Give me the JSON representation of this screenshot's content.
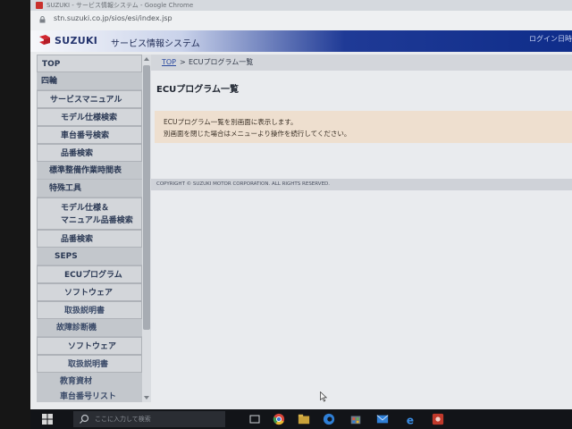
{
  "browser": {
    "title": "SUZUKI - サービス情報システム - Google Chrome",
    "url": "stn.suzuki.co.jp/sios/esi/index.jsp"
  },
  "header": {
    "brand": "SUZUKI",
    "system_name": "サービス情報システム",
    "login_text": "ログイン日時"
  },
  "sidebar": {
    "items": [
      {
        "label": "TOP"
      },
      {
        "label": "四輪"
      },
      {
        "label": "サービスマニュアル"
      },
      {
        "label": "モデル仕様検索"
      },
      {
        "label": "車台番号検索"
      },
      {
        "label": "品番検索"
      },
      {
        "label": "標準整備作業時間表"
      },
      {
        "label": "特殊工具"
      },
      {
        "label": "モデル仕様＆\nマニュアル品番検索"
      },
      {
        "label": "品番検索"
      },
      {
        "label": "SEPS"
      },
      {
        "label": "ECUプログラム"
      },
      {
        "label": "ソフトウェア"
      },
      {
        "label": "取扱説明書"
      },
      {
        "label": "故障診断機"
      },
      {
        "label": "ソフトウェア"
      },
      {
        "label": "取扱説明書"
      },
      {
        "label": "教育資材"
      },
      {
        "label": "車台番号リスト"
      }
    ]
  },
  "breadcrumb": {
    "top": "TOP",
    "separator": ">",
    "current": "ECUプログラム一覧"
  },
  "main": {
    "title": "ECUプログラム一覧",
    "notice_line1": "ECUプログラム一覧を別画面に表示します。",
    "notice_line2": "別画面を閉じた場合はメニューより操作を続行してください。",
    "copyright": "COPYRIGHT © SUZUKI MOTOR CORPORATION. ALL RIGHTS RESERVED."
  },
  "taskbar": {
    "search_placeholder": "ここに入力して検索"
  },
  "colors": {
    "header_blue": "#0f2d8a",
    "notice_bg": "#eedfcf",
    "link_blue": "#2b4aa0",
    "suzuki_red": "#d22630"
  }
}
